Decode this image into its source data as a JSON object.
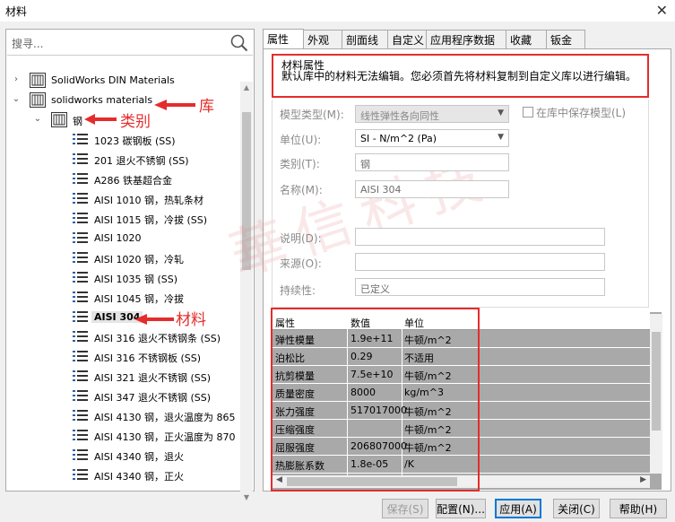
{
  "window": {
    "title": "材料",
    "close_glyph": "✕"
  },
  "search": {
    "placeholder": "搜寻..."
  },
  "tree": {
    "libraries": [
      {
        "label": "SolidWorks DIN Materials",
        "expanded": false
      },
      {
        "label": "solidworks materials",
        "expanded": true
      }
    ],
    "category": "钢",
    "materials": [
      "1023 碳钢板 (SS)",
      "201 退火不锈钢 (SS)",
      "A286 铁基超合金",
      "AISI 1010 钢，热轧条材",
      "AISI 1015 钢，冷拔 (SS)",
      "AISI 1020",
      "AISI 1020 钢，冷轧",
      "AISI 1035 钢 (SS)",
      "AISI 1045 钢，冷拔",
      "AISI 304",
      "AISI 316 退火不锈钢条 (SS)",
      "AISI 316 不锈钢板 (SS)",
      "AISI 321 退火不锈钢 (SS)",
      "AISI 347 退火不锈钢 (SS)",
      "AISI 4130 钢，退火温度为 865",
      "AISI 4130 钢，正火温度为 870",
      "AISI 4340 钢，退火",
      "AISI 4340 钢，正火"
    ],
    "selected": "AISI 304"
  },
  "annotations": {
    "library": "库",
    "category": "类别",
    "material": "材料"
  },
  "tabs": [
    "属性",
    "外观",
    "剖面线",
    "自定义",
    "应用程序数据",
    "收藏",
    "钣金"
  ],
  "properties": {
    "header": "材料属性",
    "message": "默认库中的材料无法编辑。您必须首先将材料复制到自定义库以进行编辑。",
    "model_type_label": "模型类型(M):",
    "model_type_value": "线性弹性各向同性",
    "save_in_library_label": "在库中保存模型(L)",
    "units_label": "单位(U):",
    "units_value": "SI - N/m^2 (Pa)",
    "category_label": "类别(T):",
    "category_value": "钢",
    "name_label": "名称(M):",
    "name_value": "AISI 304",
    "description_label": "说明(D):",
    "description_value": "",
    "source_label": "来源(O):",
    "source_value": "",
    "sustainability_label": "持续性:",
    "sustainability_value": "已定义"
  },
  "table": {
    "headers": [
      "属性",
      "数值",
      "单位"
    ],
    "rows": [
      [
        "弹性模量",
        "1.9e+11",
        "牛顿/m^2"
      ],
      [
        "泊松比",
        "0.29",
        "不适用"
      ],
      [
        "抗剪模量",
        "7.5e+10",
        "牛顿/m^2"
      ],
      [
        "质量密度",
        "8000",
        "kg/m^3"
      ],
      [
        "张力强度",
        "517017000",
        "牛顿/m^2"
      ],
      [
        "压缩强度",
        "",
        "牛顿/m^2"
      ],
      [
        "屈服强度",
        "206807000",
        "牛顿/m^2"
      ],
      [
        "热膨胀系数",
        "1.8e-05",
        "/K"
      ]
    ]
  },
  "buttons": {
    "save": "保存(S)",
    "config": "配置(N)...",
    "apply": "应用(A)",
    "close": "关闭(C)",
    "help": "帮助(H)"
  },
  "watermark": "华信科技",
  "colors": {
    "annotation": "#e52c2c",
    "table_bg": "#a9a9a9",
    "default_button_border": "#0078d7"
  }
}
